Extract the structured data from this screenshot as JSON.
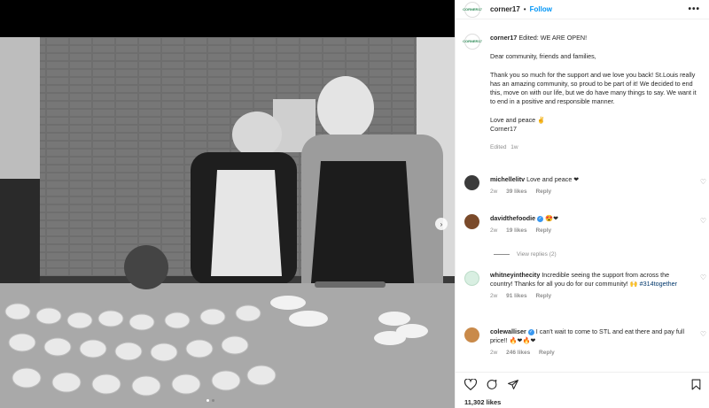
{
  "header": {
    "logo_text": "CORNER17",
    "username": "corner17",
    "separator": "•",
    "follow_label": "Follow",
    "more_label": "•••"
  },
  "caption": {
    "username": "corner17",
    "first_line": "Edited: WE ARE OPEN!",
    "paragraphs": [
      "Dear community, friends and families,",
      "Thank you so much for the support and we love you back! St.Louis really has an amazing community, so proud to be part of it! We decided to end this, move on with our life, but we do have many things to say. We want it to end in a positive and responsible manner.",
      "Love and peace ✌"
    ],
    "signature": "Corner17",
    "edited_label": "Edited",
    "time": "1w"
  },
  "comments": [
    {
      "username": "michellelitv",
      "text": "Love and peace ❤",
      "time": "2w",
      "likes": "39 likes",
      "reply_label": "Reply",
      "avatar_color": "#3b3b3b"
    },
    {
      "username": "davidthefoodie",
      "text": "😍❤",
      "time": "2w",
      "likes": "19 likes",
      "reply_label": "Reply",
      "avatar_color": "#7a4a2a",
      "verified": "✓"
    },
    {
      "username": "whitneyinthecity",
      "text": "Incredible seeing the support from across the country! Thanks for all you do for our community! 🙌",
      "hashtag": "#314together",
      "time": "2w",
      "likes": "91 likes",
      "reply_label": "Reply",
      "avatar_color": "#d9efe2"
    },
    {
      "username": "colewalliser",
      "text": "I can't wait to come to STL and eat there and pay full price!! 🔥❤🔥❤",
      "time": "2w",
      "likes": "246 likes",
      "reply_label": "Reply",
      "avatar_color": "#c98a4a",
      "verified": "✓"
    }
  ],
  "view_replies": "View replies (2)",
  "icons": {
    "heart": "♡",
    "next": "›"
  },
  "likes_total": "11,302 likes",
  "colors": {
    "accent": "#0095f6",
    "brand_green": "#2e8b57",
    "heart_red": "#ed4956"
  }
}
